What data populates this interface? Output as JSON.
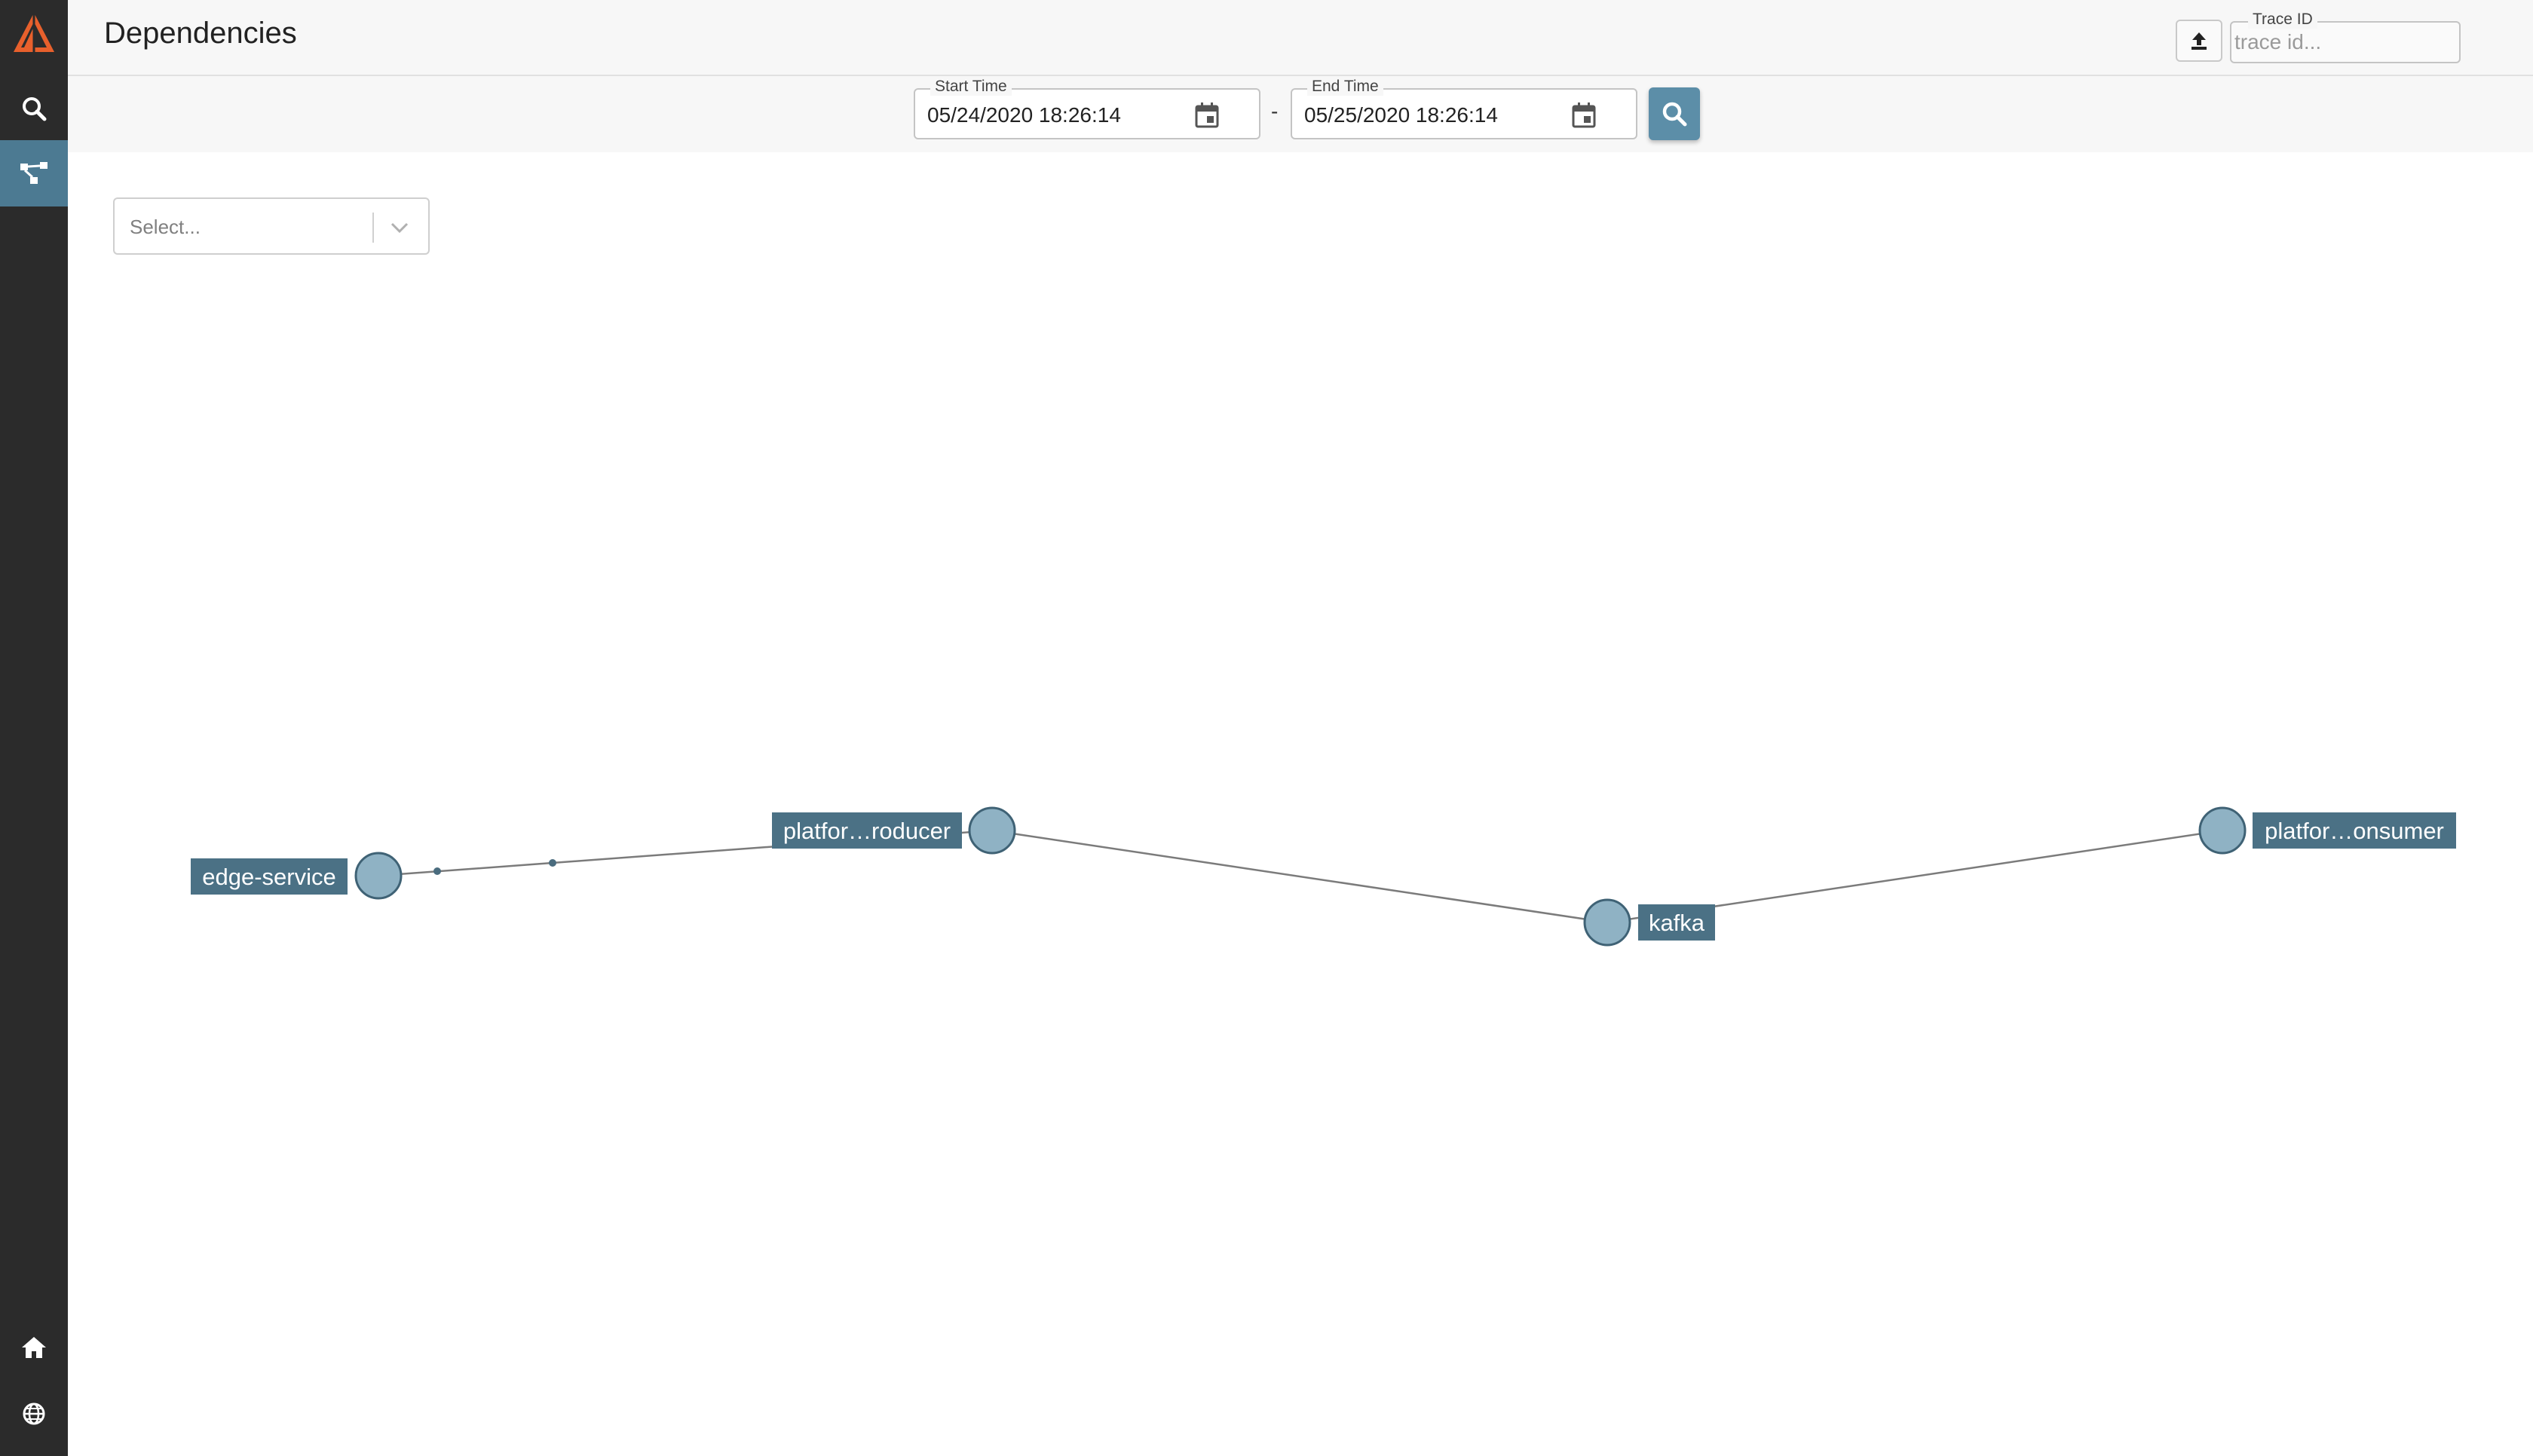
{
  "app": {
    "page_title": "Dependencies",
    "accent_color": "#4c7a92",
    "brand_color": "#e8602c"
  },
  "sidebar": {
    "items": [
      {
        "name": "logo",
        "icon": "app-logo-icon"
      },
      {
        "name": "search",
        "icon": "search-icon"
      },
      {
        "name": "dependencies",
        "icon": "dependency-graph-icon",
        "active": true
      },
      {
        "name": "home",
        "icon": "home-icon"
      },
      {
        "name": "language",
        "icon": "globe-icon"
      }
    ]
  },
  "header": {
    "upload_icon": "upload-icon",
    "trace_id": {
      "label": "Trace ID",
      "placeholder": "trace id..."
    }
  },
  "timebar": {
    "start": {
      "label": "Start Time",
      "value": "05/24/2020 18:26:14"
    },
    "separator": "-",
    "end": {
      "label": "End Time",
      "value": "05/25/2020 18:26:14"
    },
    "search_icon": "search-icon"
  },
  "filter": {
    "placeholder": "Select..."
  },
  "graph": {
    "nodes": [
      {
        "id": "edge-service",
        "label": "edge-service"
      },
      {
        "id": "platform-producer",
        "label": "platfor…roducer"
      },
      {
        "id": "kafka",
        "label": "kafka"
      },
      {
        "id": "platform-consumer",
        "label": "platfor…onsumer"
      }
    ],
    "edges": [
      {
        "from": "edge-service",
        "to": "platform-producer"
      },
      {
        "from": "platform-producer",
        "to": "kafka"
      },
      {
        "from": "kafka",
        "to": "platform-consumer"
      }
    ]
  }
}
